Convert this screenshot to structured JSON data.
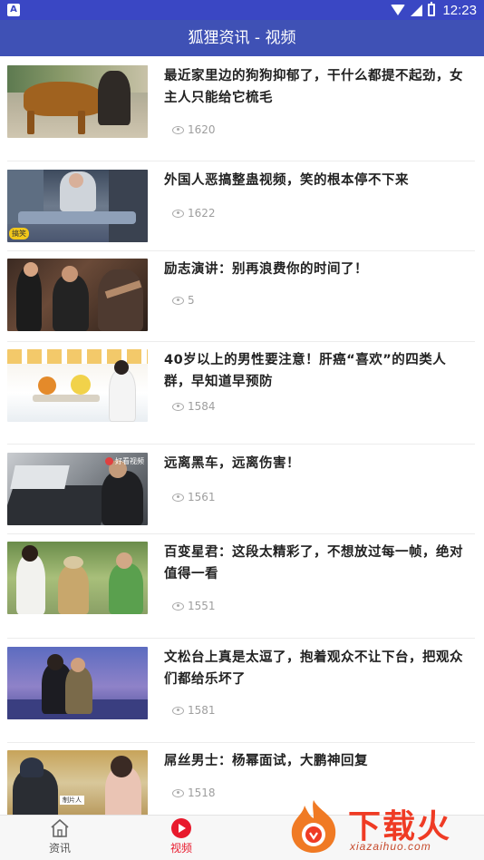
{
  "status_bar": {
    "app_badge": "A",
    "time": "12:23",
    "icons": [
      "wifi-icon",
      "signal-icon",
      "battery-charging-icon"
    ]
  },
  "app_bar": {
    "title": "狐狸资讯 - 视频"
  },
  "feed": [
    {
      "title": "最近家里边的狗狗抑郁了，干什么都提不起劲，女主人只能给它梳毛",
      "views": "1620"
    },
    {
      "title": "外国人恶搞整蛊视频，笑的根本停不下来",
      "views": "1622",
      "thumb_badge": "搞笑"
    },
    {
      "title": "励志演讲：别再浪费你的时间了！",
      "views": "5"
    },
    {
      "title": "40岁以上的男性要注意！肝癌“喜欢”的四类人群，早知道早预防",
      "views": "1584"
    },
    {
      "title": "远离黑车，远离伤害！",
      "views": "1561",
      "thumb_logo": "好看视频"
    },
    {
      "title": "百变星君：这段太精彩了，不想放过每一帧，绝对值得一看",
      "views": "1551"
    },
    {
      "title": "文松台上真是太逗了，抱着观众不让下台，把观众们都给乐坏了",
      "views": "1581"
    },
    {
      "title": "屌丝男士：杨幂面试，大鹏神回复",
      "views": "1518",
      "thumb_caption": "制片人"
    }
  ],
  "tab_bar": {
    "tabs": [
      {
        "label": "资讯",
        "icon": "home-icon",
        "active": false
      },
      {
        "label": "视频",
        "icon": "play-circle-icon",
        "active": true
      }
    ]
  },
  "watermark": {
    "text": "下载火",
    "url": "xiazaihuo.com"
  },
  "colors": {
    "status_bar": "#3a47c4",
    "app_bar": "#3f51b5",
    "active_tab": "#e8192c",
    "watermark": "#ef3b24"
  }
}
